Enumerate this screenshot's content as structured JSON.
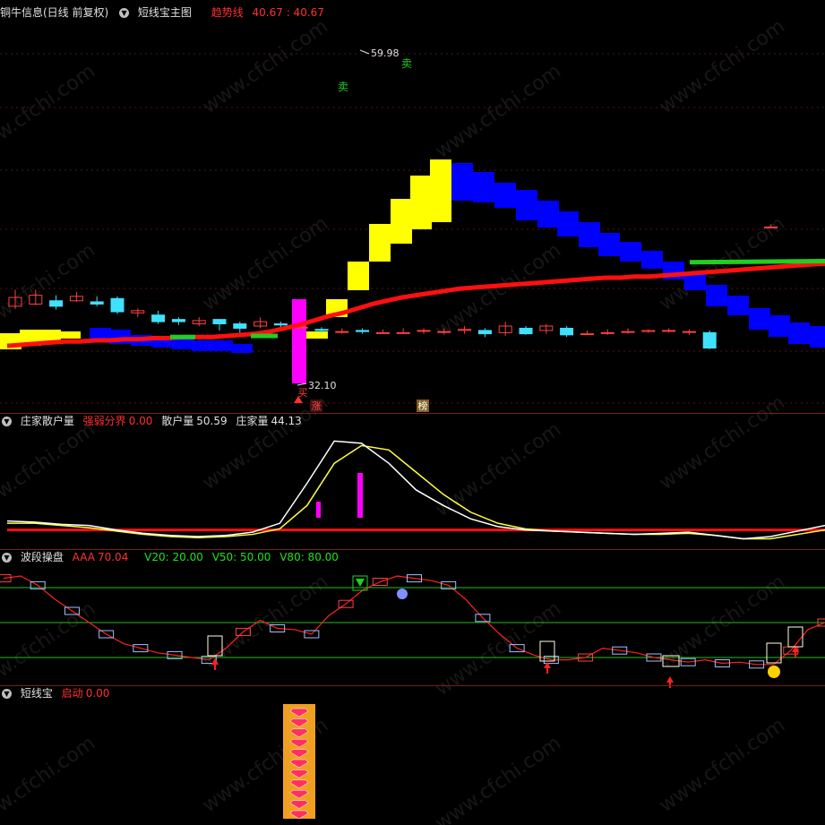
{
  "main_header": {
    "security": "铜牛信息(日线 前复权)",
    "indicator": "短线宝主图",
    "trend_label": "趋势线",
    "trend_values": "40.67 : 40.67",
    "colors": {
      "label": "#ff3030",
      "value": "#ff3030"
    }
  },
  "panel2_header": {
    "name": "庄家散户量",
    "field1_label": "强弱分界",
    "field1_value": "0.00",
    "field2_label": "散户量",
    "field2_value": "50.59",
    "field3_label": "庄家量",
    "field3_value": "44.13"
  },
  "panel3_header": {
    "name": "波段操盘",
    "aaa_label": "AAA",
    "aaa_value": "70.04",
    "v20": "V20: 20.00",
    "v50": "V50: 50.00",
    "v80": "V80: 80.00"
  },
  "panel4_header": {
    "name": "短线宝",
    "start_label": "启动",
    "start_value": "0.00"
  },
  "watermark": "www.cfchi.com",
  "colors": {
    "up": "#ff4040",
    "down": "#40e0ff",
    "trend": "#ff1010",
    "yellow": "#ffff00",
    "blue": "#0000ff",
    "green": "#20c020",
    "magenta": "#ff00ff",
    "white": "#ffffff",
    "bg": "#000000"
  },
  "chart_data": [
    {
      "type": "candlestick",
      "title": "短线宝主图",
      "ylim": [
        28,
        63
      ],
      "annotations": {
        "high": "59.98",
        "low": "32.10",
        "sell": "卖",
        "buy": "买",
        "rise": "涨",
        "board": "榜"
      },
      "candles": [
        [
          36.8,
          37.6,
          38.3,
          36.6
        ],
        [
          37.0,
          37.8,
          38.3,
          36.9
        ],
        [
          37.3,
          36.8,
          37.8,
          36.5
        ],
        [
          37.3,
          37.7,
          38.1,
          37.2
        ],
        [
          37.2,
          37.0,
          37.7,
          36.8
        ],
        [
          37.5,
          36.3,
          37.7,
          36.1
        ],
        [
          36.2,
          36.4,
          36.6,
          35.8
        ],
        [
          36.0,
          35.4,
          36.4,
          35.2
        ],
        [
          35.6,
          35.4,
          35.8,
          35.1
        ],
        [
          35.2,
          35.5,
          35.8,
          35.0
        ],
        [
          35.6,
          35.2,
          35.6,
          34.6
        ],
        [
          35.2,
          34.8,
          35.4,
          34.4
        ],
        [
          35.0,
          35.4,
          35.8,
          34.8
        ],
        [
          35.2,
          35.1,
          35.4,
          34.8
        ],
        [
          34.9,
          34.9,
          35.3,
          34.8
        ],
        [
          34.7,
          34.6,
          34.9,
          34.4
        ],
        [
          34.5,
          34.5,
          34.8,
          34.3
        ],
        [
          34.6,
          34.5,
          34.8,
          34.3
        ],
        [
          34.4,
          34.4,
          34.7,
          34.3
        ],
        [
          34.4,
          34.4,
          34.8,
          34.3
        ],
        [
          34.6,
          34.6,
          34.8,
          34.3
        ],
        [
          34.5,
          34.5,
          34.8,
          34.3
        ],
        [
          34.6,
          34.7,
          35.0,
          34.3
        ],
        [
          34.6,
          34.3,
          34.8,
          34.0
        ],
        [
          34.4,
          35.0,
          35.4,
          34.1
        ],
        [
          34.8,
          34.3,
          35.0,
          34.2
        ],
        [
          34.6,
          35.0,
          35.2,
          34.3
        ],
        [
          34.8,
          34.2,
          35.0,
          34.0
        ],
        [
          34.3,
          34.3,
          34.6,
          34.2
        ],
        [
          34.4,
          34.4,
          34.7,
          34.2
        ],
        [
          34.5,
          34.5,
          34.8,
          34.3
        ],
        [
          34.5,
          34.6,
          34.7,
          34.4
        ],
        [
          34.6,
          34.6,
          34.8,
          34.4
        ],
        [
          34.5,
          34.5,
          34.7,
          34.2
        ],
        [
          34.4,
          33.0,
          34.6,
          32.9
        ],
        [
          null,
          null,
          null,
          null
        ],
        [
          null,
          null,
          null,
          null
        ],
        [
          44.0,
          44.0,
          44.2,
          44.0
        ],
        [
          null,
          null,
          null,
          null
        ],
        [
          null,
          null,
          null,
          null
        ],
        [
          null,
          null,
          null,
          null
        ],
        [
          null,
          null,
          null,
          null
        ],
        [
          null,
          null,
          null,
          null
        ],
        [
          null,
          null,
          null,
          null
        ],
        [
          null,
          null,
          null,
          null
        ],
        [
          null,
          null,
          null,
          null
        ],
        [
          null,
          null,
          null,
          null
        ],
        [
          null,
          null,
          null,
          null
        ],
        [
          null,
          null,
          null,
          null
        ],
        [
          50.8,
          52.4,
          55.2,
          49.2
        ],
        [
          54.0,
          58.5,
          59.98,
          53.5
        ],
        [
          54.5,
          56.5,
          58.5,
          53.8
        ],
        [
          57.5,
          49.0,
          58.4,
          48.7
        ],
        [
          46.5,
          46.5,
          48.2,
          43.0
        ],
        [
          45.2,
          46.3,
          47.0,
          44.9
        ],
        [
          44.5,
          41.8,
          45.4,
          41.6
        ],
        [
          41.2,
          40.8,
          42.1,
          40.1
        ],
        [
          40.2,
          39.1,
          40.4,
          38.7
        ],
        [
          39.2,
          39.2,
          39.8,
          38.8
        ],
        [
          39.4,
          41.8,
          42.3,
          38.9
        ],
        [
          40.2,
          38.9,
          40.5,
          38.3
        ],
        [
          38.8,
          35.8,
          39.1,
          35.6
        ],
        [
          36.0,
          37.2,
          37.6,
          35.8
        ],
        [
          36.4,
          36.2,
          36.8,
          35.9
        ],
        [
          36.2,
          36.0,
          36.7,
          35.7
        ],
        [
          36.3,
          36.9,
          38.4,
          35.6
        ],
        [
          36.7,
          36.5,
          37.0,
          36.4
        ],
        [
          36.8,
          34.4,
          37.1,
          34.2
        ],
        [
          34.5,
          34.4,
          34.8,
          34.2
        ],
        [
          33.9,
          32.5,
          34.1,
          32.3
        ],
        [
          33.2,
          33.8,
          34.3,
          33.0
        ],
        [
          33.8,
          33.8,
          34.4,
          33.4
        ],
        [
          33.4,
          32.2,
          33.8,
          32.0
        ],
        [
          33.0,
          33.4,
          33.8,
          32.6
        ],
        [
          33.5,
          33.2,
          33.8,
          33.0
        ]
      ],
      "trend_line": [
        33.2,
        33.3,
        33.4,
        33.5,
        33.6,
        33.6,
        33.7,
        33.7,
        33.8,
        33.8,
        33.9,
        33.9,
        34.0,
        34.0,
        34.0,
        34.1,
        34.2,
        34.3,
        34.5,
        34.8,
        35.1,
        35.5,
        35.9,
        36.2,
        36.6,
        37.0,
        37.3,
        37.6,
        37.8,
        38.0,
        38.2,
        38.4,
        38.5,
        38.6,
        38.7,
        38.8,
        38.9,
        39.0,
        39.1,
        39.2,
        39.3,
        39.4,
        39.4,
        39.5,
        39.5,
        39.6,
        39.7,
        39.8,
        39.9,
        40.0,
        40.1,
        40.2,
        40.3,
        40.4,
        40.5,
        40.6,
        40.67
      ]
    },
    {
      "type": "line",
      "title": "庄家散户量",
      "ylim": [
        0,
        100
      ],
      "series": [
        {
          "name": "散户量",
          "values": [
            18,
            17,
            15,
            14,
            10,
            7,
            5,
            4,
            5,
            8,
            16,
            52,
            90,
            88,
            70,
            46,
            32,
            20,
            13,
            10,
            9,
            8,
            7,
            6,
            7,
            8,
            5,
            2,
            4,
            9,
            14
          ]
        },
        {
          "name": "庄家量",
          "values": [
            16,
            16,
            14,
            12,
            9,
            6,
            4,
            3,
            4,
            6,
            11,
            32,
            70,
            86,
            82,
            62,
            42,
            26,
            16,
            11,
            9,
            8,
            7,
            6,
            6,
            7,
            5,
            2,
            2,
            6,
            10
          ]
        },
        {
          "name": "强弱分界",
          "values": [
            10,
            10,
            10,
            10,
            10,
            10,
            10,
            10,
            10,
            10,
            10,
            10,
            10,
            10,
            10,
            10,
            10,
            10,
            10,
            10,
            10,
            10,
            10,
            10,
            10,
            10,
            10,
            10,
            10,
            10,
            10
          ]
        }
      ]
    },
    {
      "type": "line",
      "title": "波段操盘",
      "ylim": [
        0,
        100
      ],
      "levels": [
        20,
        50,
        80
      ],
      "values": [
        88,
        90,
        82,
        70,
        60,
        50,
        40,
        32,
        28,
        24,
        22,
        20,
        18,
        28,
        42,
        52,
        45,
        44,
        40,
        56,
        66,
        78,
        85,
        90,
        88,
        86,
        82,
        70,
        54,
        40,
        28,
        22,
        18,
        18,
        20,
        28,
        26,
        24,
        20,
        18,
        16,
        18,
        15,
        16,
        14,
        14,
        26,
        44,
        50
      ]
    },
    {
      "type": "bar",
      "title": "短线宝",
      "values": [
        1
      ],
      "stack_icons": 11
    }
  ]
}
